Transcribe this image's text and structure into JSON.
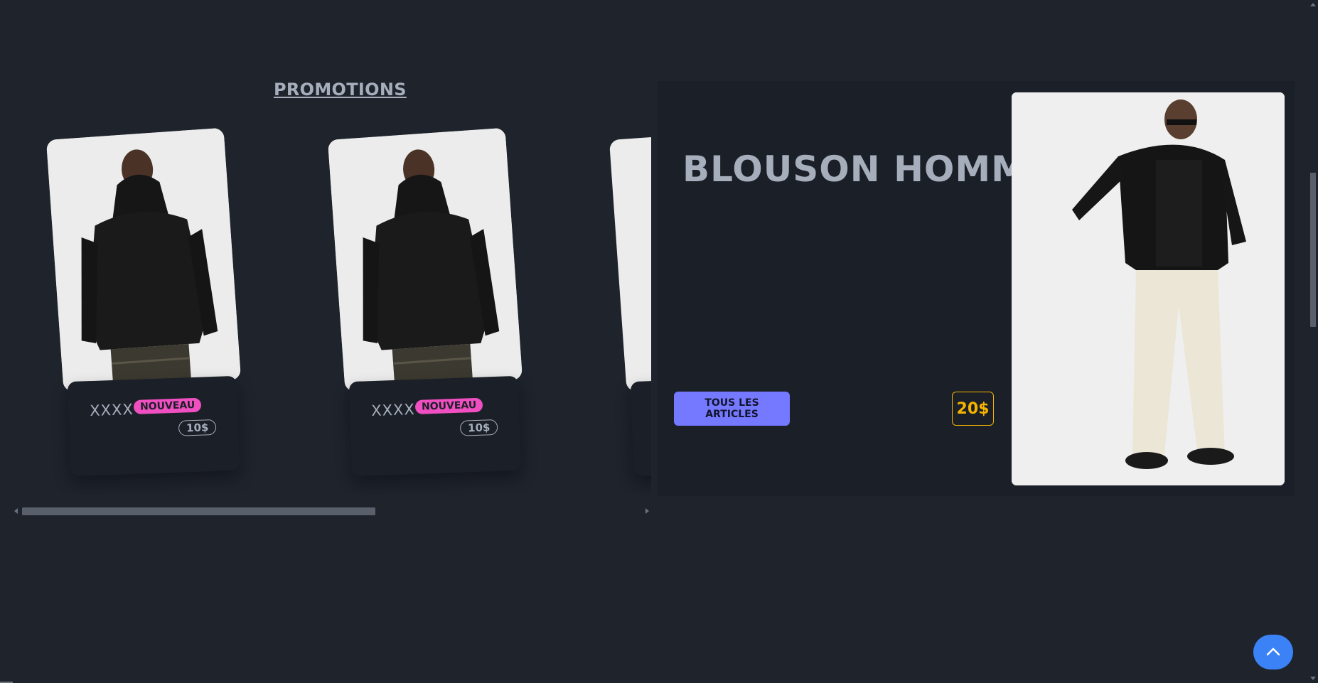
{
  "promotions": {
    "title": "PROMOTIONS",
    "cards": [
      {
        "name": "XXXX",
        "badge": "NOUVEAU",
        "price": "10$"
      },
      {
        "name": "XXXX",
        "badge": "NOUVEAU",
        "price": "10$"
      }
    ]
  },
  "hero": {
    "title": "BLOUSON HOMME",
    "button_label": "TOUS LES ARTICLES",
    "price": "20$"
  },
  "colors": {
    "background": "#1e232c",
    "card": "#1b1f27",
    "badge_new": "#ef4fc0",
    "primary_button": "#7579ff",
    "price_accent": "#f5b400",
    "to_top_button": "#3b82f6"
  },
  "icons": {
    "to_top": "chevron-up-icon"
  }
}
